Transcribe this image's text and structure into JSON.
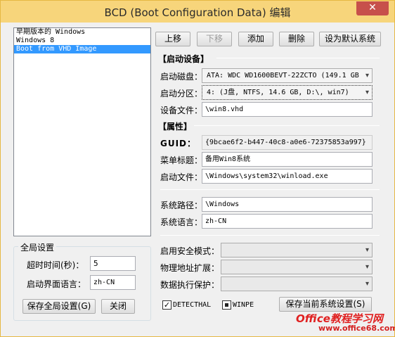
{
  "window": {
    "title": "BCD (Boot Configuration Data) 编辑",
    "close_glyph": "✕"
  },
  "boot_list": {
    "items": [
      "早期版本的 Windows",
      "Windows 8",
      "Boot from VHD Image"
    ],
    "selected_index": 2
  },
  "toolbar": {
    "move_up": "上移",
    "move_down": "下移",
    "add": "添加",
    "delete": "删除",
    "set_default": "设为默认系统"
  },
  "boot_device": {
    "section_title": "【启动设备】",
    "disk_label": "启动磁盘：",
    "disk_value": "ATA: WDC WD1600BEVT-22ZCTO (149.1 GB",
    "partition_label": "启动分区：",
    "partition_value": "4: (J盘, NTFS, 14.6 GB, D:\\, win7)",
    "device_file_label": "设备文件：",
    "device_file_value": "\\win8.vhd"
  },
  "properties": {
    "section_title": "【属性】",
    "guid_label": "GUID：",
    "guid_value": "{9bcae6f2-b447-40c8-a0e6-72375853a997}",
    "menu_title_label": "菜单标题：",
    "menu_title_value": "备用Win8系统",
    "boot_file_label": "启动文件：",
    "boot_file_value": "\\Windows\\system32\\winload.exe",
    "system_path_label": "系统路径：",
    "system_path_value": "\\Windows",
    "system_lang_label": "系统语言：",
    "system_lang_value": "zh-CN",
    "safe_mode_label": "启用安全模式：",
    "safe_mode_value": "",
    "pae_label": "物理地址扩展：",
    "pae_value": "",
    "dep_label": "数据执行保护：",
    "dep_value": "",
    "detecthal_label": "DETECTHAL",
    "detecthal_checked": true,
    "winpe_label": "WINPE",
    "winpe_checked": false,
    "save_current": "保存当前系统设置(S)"
  },
  "global": {
    "section_title": "全局设置",
    "timeout_label": "超时时间(秒)：",
    "timeout_value": "5",
    "ui_lang_label": "启动界面语言：",
    "ui_lang_value": "zh-CN",
    "save_global": "保存全局设置(G)",
    "close": "关闭"
  },
  "watermark": {
    "brand": "Office教程学习网",
    "url": "www.office68.com"
  },
  "icons": {
    "dropdown_arrow": "▾",
    "check": "✓"
  }
}
